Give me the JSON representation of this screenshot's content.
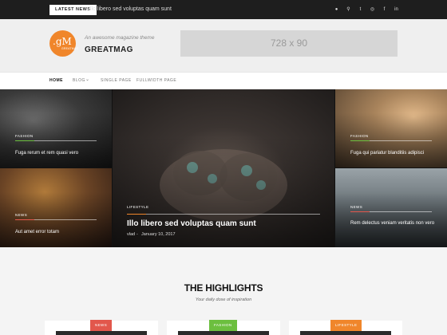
{
  "topbar": {
    "latest_label": "LATEST NEWS",
    "latest_headline": "Illo libero sed voluptas quam sunt",
    "social_icons": [
      "user-icon",
      "search-icon",
      "twitter-icon",
      "instagram-icon",
      "facebook-icon",
      "linkedin-icon"
    ],
    "social_glyphs": [
      "●",
      "⚲",
      "t",
      "◎",
      "f",
      "in"
    ]
  },
  "brand": {
    "logo_letters": ".gM",
    "logo_sub": "GREATMAG",
    "tagline": "An awesome magazine theme",
    "title": "GREATMAG",
    "logo_color": "#f0862b"
  },
  "ad": {
    "label": "728 x 90"
  },
  "nav": {
    "items": [
      {
        "label": "HOME",
        "active": true
      },
      {
        "label": "BLOG",
        "has_dropdown": true
      },
      {
        "label": "SINGLE PAGE"
      },
      {
        "label": "FULLWIDTH PAGE"
      }
    ],
    "dropdown_glyph": "⌄"
  },
  "featured": {
    "posts": [
      {
        "category": "FASHION",
        "title": "Fuga rerum et rem quasi vero",
        "accent": "#6cbf3f"
      },
      {
        "category": "NEWS",
        "title": "Aut amet error totam",
        "accent": "#e2574c"
      },
      {
        "category": "LIFESTYLE",
        "title": "Illo libero sed voluptas quam sunt",
        "author": "vlad",
        "separator": "-",
        "date": "January 10, 2017",
        "accent": "#f0862b"
      },
      {
        "category": "FASHION",
        "title": "Fuga qui pariatur blanditiis adipisci",
        "accent": "#6cbf3f"
      },
      {
        "category": "NEWS",
        "title": "Rem delectus veniam veritatis non vero",
        "accent": "#e2574c"
      }
    ]
  },
  "highlights": {
    "title": "THE HIGHLIGHTS",
    "subtitle": "Your daily dose of inspiration",
    "cards": [
      {
        "category": "NEWS",
        "color": "#e2574c"
      },
      {
        "category": "FASHION",
        "color": "#6cbf3f"
      },
      {
        "category": "LIFESTYLE",
        "color": "#f0862b"
      }
    ]
  }
}
